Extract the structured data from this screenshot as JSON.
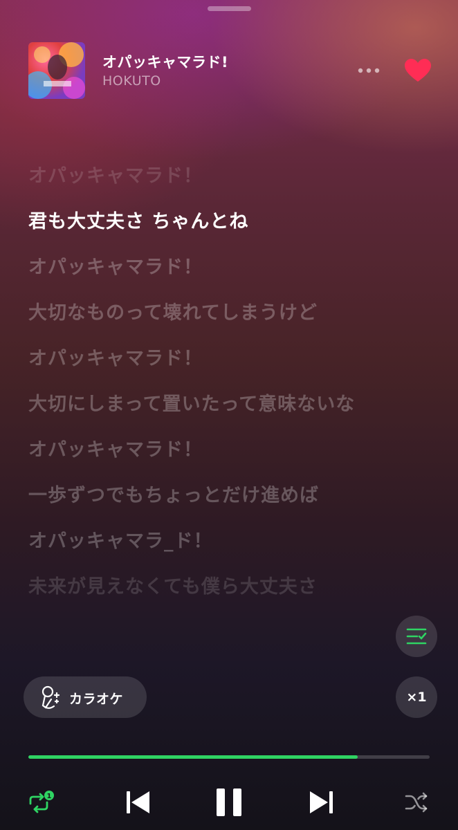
{
  "track": {
    "title": "オパッキャマラド!",
    "artist": "HOKUTO",
    "liked": true
  },
  "lyrics": [
    {
      "text": "オパッキャマラド！",
      "state": "past"
    },
    {
      "text": "君も大丈夫さ ちゃんとね",
      "state": "active"
    },
    {
      "text": "オパッキャマラド！",
      "state": "upcoming"
    },
    {
      "text": "大切なものって壊れてしまうけど",
      "state": "upcoming"
    },
    {
      "text": "オパッキャマラド！",
      "state": "upcoming"
    },
    {
      "text": "大切にしまって置いたって意味ないな",
      "state": "upcoming"
    },
    {
      "text": "オパッキャマラド！",
      "state": "upcoming"
    },
    {
      "text": "一歩ずつでもちょっとだけ進めば",
      "state": "upcoming"
    },
    {
      "text": "オパッキャマラ_ド！",
      "state": "upcoming"
    },
    {
      "text": "未来が見えなくても僕ら大丈夫さ",
      "state": "fade"
    }
  ],
  "karaoke": {
    "label": "カラオケ"
  },
  "speed": {
    "label": "×1"
  },
  "playback": {
    "progress": 0.82,
    "repeat_badge": "1",
    "state": "playing"
  },
  "colors": {
    "accent": "#2fd463",
    "heart": "#ff2d55"
  },
  "icons": [
    "more-icon",
    "heart-icon",
    "queue-icon",
    "karaoke-mic-icon",
    "repeat-one-icon",
    "previous-icon",
    "pause-icon",
    "next-icon",
    "shuffle-icon"
  ]
}
